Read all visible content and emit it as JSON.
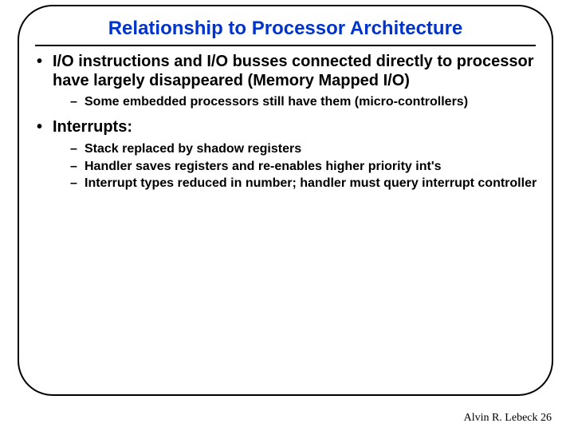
{
  "title": "Relationship to Processor Architecture",
  "bullets": [
    {
      "text": "I/O instructions and I/O busses connected directly to processor have largely disappeared (Memory Mapped I/O)",
      "sub": [
        "Some embedded processors still have them (micro-controllers)"
      ]
    },
    {
      "text": "Interrupts:",
      "sub": [
        "Stack replaced by shadow registers",
        "Handler saves registers and re-enables higher priority int's",
        "Interrupt types reduced in number; handler must query interrupt controller"
      ]
    }
  ],
  "footer": {
    "author": "Alvin R. Lebeck",
    "page": "26"
  }
}
